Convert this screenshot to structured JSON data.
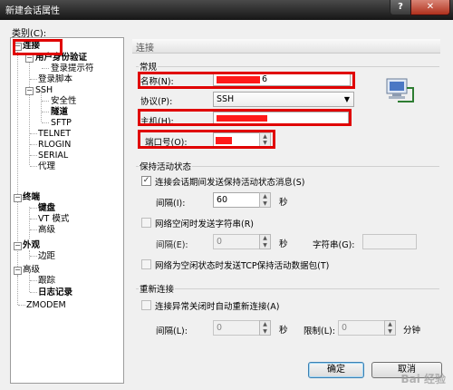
{
  "window": {
    "title": "新建会话属性",
    "help_glyph": "?",
    "close_glyph": "✕"
  },
  "category_label": "类别(C):",
  "tree": [
    {
      "id": "conn",
      "label": "连接",
      "bold": true
    },
    {
      "id": "auth",
      "label": "用户身份验证",
      "bold": true
    },
    {
      "id": "login_prompt",
      "label": "登录提示符",
      "bold": false
    },
    {
      "id": "login_script",
      "label": "登录脚本",
      "bold": false
    },
    {
      "id": "ssh",
      "label": "SSH",
      "bold": false
    },
    {
      "id": "security",
      "label": "安全性",
      "bold": false
    },
    {
      "id": "tunnel",
      "label": "隧道",
      "bold": true
    },
    {
      "id": "sftp",
      "label": "SFTP",
      "bold": false
    },
    {
      "id": "telnet",
      "label": "TELNET",
      "bold": false
    },
    {
      "id": "rlogin",
      "label": "RLOGIN",
      "bold": false
    },
    {
      "id": "serial",
      "label": "SERIAL",
      "bold": false
    },
    {
      "id": "proxy",
      "label": "代理",
      "bold": false
    },
    {
      "id": "terminal",
      "label": "终端",
      "bold": true
    },
    {
      "id": "keyboard",
      "label": "键盘",
      "bold": true
    },
    {
      "id": "vt",
      "label": "VT 模式",
      "bold": false
    },
    {
      "id": "advanced",
      "label": "高级",
      "bold": false
    },
    {
      "id": "appearance",
      "label": "外观",
      "bold": true
    },
    {
      "id": "margin",
      "label": "边距",
      "bold": false
    },
    {
      "id": "adv2",
      "label": "高级",
      "bold": false
    },
    {
      "id": "trace",
      "label": "跟踪",
      "bold": false
    },
    {
      "id": "log",
      "label": "日志记录",
      "bold": true
    },
    {
      "id": "zmodem",
      "label": "ZMODEM",
      "bold": false
    }
  ],
  "section_header": "连接",
  "general": {
    "title": "常规",
    "name_label": "名称(N):",
    "name_suffix": "6",
    "protocol_label": "协议(P):",
    "protocol_value": "SSH",
    "host_label": "主机(H):",
    "port_label": "端口号(O):"
  },
  "keepalive": {
    "title": "保持活动状态",
    "send_msg_label": "连接会话期间发送保持活动状态消息(S)",
    "send_msg_checked": true,
    "interval_label": "间隔(I):",
    "interval_value": "60",
    "seconds": "秒",
    "idle_send_label": "网络空闲时发送字符串(R)",
    "idle_send_checked": false,
    "interval2_label": "间隔(E):",
    "interval2_value": "0",
    "seconds2": "秒",
    "string_label": "字符串(G):",
    "tcp_label": "网络为空闲状态时发送TCP保持活动数据包(T)",
    "tcp_checked": false
  },
  "reconnect": {
    "title": "重新连接",
    "auto_label": "连接异常关闭时自动重新连接(A)",
    "auto_checked": false,
    "interval_label": "间隔(L):",
    "interval_value": "0",
    "seconds": "秒",
    "limit_label": "限制(L):",
    "limit_value": "0",
    "minutes": "分钟"
  },
  "buttons": {
    "ok": "确定",
    "cancel": "取消"
  },
  "watermark": "Bai 经验"
}
